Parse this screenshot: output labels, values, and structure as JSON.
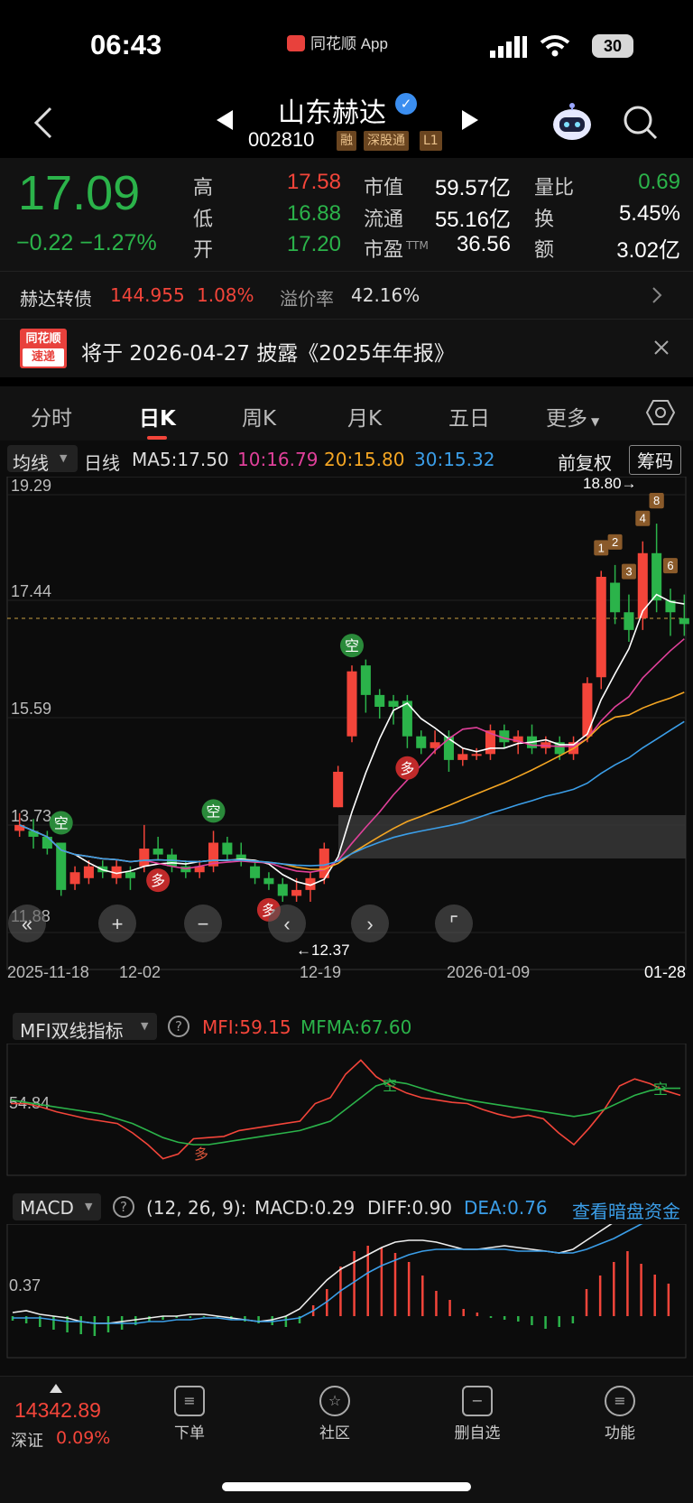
{
  "status_bar": {
    "time": "06:43",
    "app_label": "同花顺 App",
    "battery": "30"
  },
  "header": {
    "name": "山东赫达",
    "code": "002810",
    "tags": [
      "融",
      "深股通",
      "L1"
    ]
  },
  "quote": {
    "price": "17.09",
    "change": "−0.22  −1.27%",
    "high_label": "高",
    "high": "17.58",
    "low_label": "低",
    "low": "16.88",
    "open_label": "开",
    "open": "17.20",
    "mcap_label": "市值",
    "mcap": "59.57亿",
    "float_label": "流通",
    "float": "55.16亿",
    "pe_label": "市盈",
    "pe_sup": "TTM",
    "pe": "36.56",
    "vr_label": "量比",
    "vr": "0.69",
    "turnover_label": "换",
    "turnover": "5.45%",
    "amount_label": "额",
    "amount": "3.02亿"
  },
  "convertible": {
    "name": "赫达转债",
    "price": "144.955",
    "pct": "1.08%",
    "premium_label": "溢价率",
    "premium": "42.16%"
  },
  "news": {
    "logo_line1": "同花顺",
    "logo_line2": "速递",
    "text": "将于 2026-04-27 披露《2025年年报》"
  },
  "tabs": [
    "分时",
    "日K",
    "周K",
    "月K",
    "五日",
    "更多"
  ],
  "active_tab": "日K",
  "kline": {
    "indicator": "均线",
    "period": "日线",
    "ma5": "MA5:17.50",
    "ma10": "10:16.79",
    "ma20": "20:15.80",
    "ma30": "30:15.32",
    "adjust": "前复权",
    "chips": "筹码",
    "y_ticks": [
      "19.29",
      "17.44",
      "15.59",
      "13.73",
      "11.88"
    ],
    "max_label": "18.80→",
    "min_label": "←12.37",
    "x_ticks": [
      "2025-11-18",
      "12-02",
      "12-19",
      "2026-01-09",
      "01-28"
    ],
    "markers_duo": "多",
    "markers_kong": "空",
    "event_numbers": [
      "1",
      "2",
      "3",
      "4",
      "5",
      "6",
      "7",
      "8"
    ]
  },
  "mfi": {
    "name": "MFI双线指标",
    "mfi": "MFI:59.15",
    "mfma": "MFMA:67.60",
    "y_tick": "54.84"
  },
  "macd": {
    "name": "MACD",
    "params": "(12, 26, 9):",
    "macd": "MACD:0.29",
    "diff": "DIFF:0.90",
    "dea": "DEA:0.76",
    "link": "查看暗盘资金",
    "y_tick": "0.37"
  },
  "bottom": {
    "index_value": "14342.89",
    "index_name": "深证",
    "index_pct": "0.09%",
    "nav": [
      "下单",
      "社区",
      "删自选",
      "功能"
    ]
  },
  "colors": {
    "up": "#f3453a",
    "down": "#2bb34a",
    "ma5": "#ffffff",
    "ma10": "#e0409a",
    "ma20": "#f5a623",
    "ma30": "#3b9ee8"
  }
}
